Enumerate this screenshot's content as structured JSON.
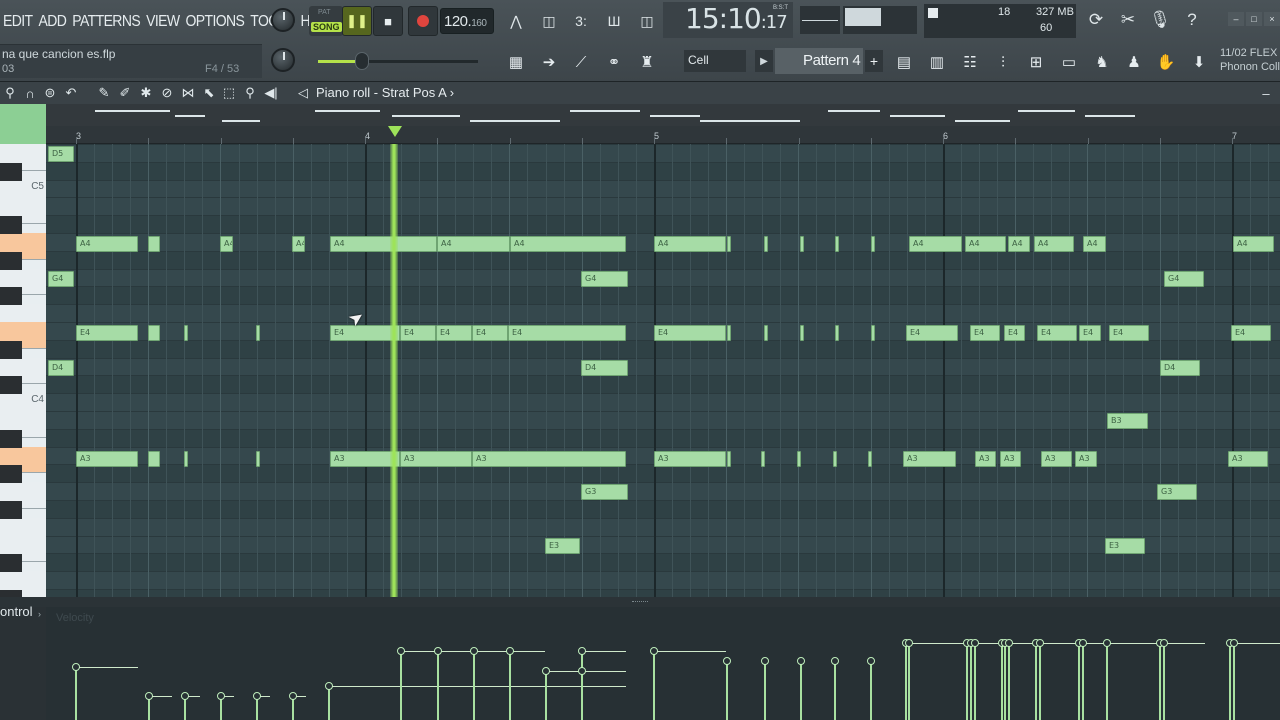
{
  "menu": [
    "EDIT",
    "ADD",
    "PATTERNS",
    "VIEW",
    "OPTIONS",
    "TOOLS",
    "HELP"
  ],
  "file": {
    "name": "na que cancion es.flp",
    "index": "03",
    "position": "F4 / 53"
  },
  "transport": {
    "song_label": "SONG",
    "pat_label": "PAT",
    "play_icon": "pause-icon",
    "stop_icon": "stop-icon",
    "record_icon": "record-icon",
    "tempo": "120.",
    "tempo_decimal": "160",
    "time_main": "15:10",
    "time_sub": ":17",
    "time_unit": "B:S:T"
  },
  "perf": {
    "poly": "18",
    "memory": "327 MB",
    "voices": "60"
  },
  "snap": "Cell",
  "pattern": "Pattern 4",
  "news": {
    "date": "11/02",
    "label": "FLEX",
    "text": "Phonon Coll"
  },
  "piano_roll": {
    "title": "Piano roll - Strat Pos A",
    "title_arrow": "›"
  },
  "ruler_numbers": [
    "3",
    "4",
    "5",
    "6",
    "7"
  ],
  "key_labels": [
    "C5",
    "C4"
  ],
  "control": {
    "label": "ontrol",
    "arrow": "›",
    "ghost": "Velocity"
  },
  "notes": [
    {
      "label": "D5"
    },
    {
      "label": "A4"
    },
    {
      "label": ""
    },
    {
      "label": "A4"
    },
    {
      "label": "A4"
    },
    {
      "label": "A4"
    },
    {
      "label": "A4"
    },
    {
      "label": "A4"
    },
    {
      "label": "A4"
    },
    {
      "label": ""
    },
    {
      "label": ""
    },
    {
      "label": ""
    },
    {
      "label": ""
    },
    {
      "label": ""
    },
    {
      "label": "A4"
    },
    {
      "label": "A4"
    },
    {
      "label": "A4"
    },
    {
      "label": "A4"
    },
    {
      "label": "A4"
    },
    {
      "label": "A4"
    },
    {
      "label": "G4"
    },
    {
      "label": "G4"
    },
    {
      "label": "G4"
    },
    {
      "label": "E4"
    },
    {
      "label": ""
    },
    {
      "label": ""
    },
    {
      "label": ""
    },
    {
      "label": "E4"
    },
    {
      "label": "E4"
    },
    {
      "label": "E4"
    },
    {
      "label": "E4"
    },
    {
      "label": "E4"
    },
    {
      "label": "E4"
    },
    {
      "label": ""
    },
    {
      "label": ""
    },
    {
      "label": ""
    },
    {
      "label": ""
    },
    {
      "label": ""
    },
    {
      "label": "E4"
    },
    {
      "label": "E4"
    },
    {
      "label": "E4"
    },
    {
      "label": "E4"
    },
    {
      "label": "E4"
    },
    {
      "label": "E4"
    },
    {
      "label": "E4"
    },
    {
      "label": "D4"
    },
    {
      "label": "D4"
    },
    {
      "label": "D4"
    },
    {
      "label": "B3"
    },
    {
      "label": "A3"
    },
    {
      "label": ""
    },
    {
      "label": ""
    },
    {
      "label": ""
    },
    {
      "label": "A3"
    },
    {
      "label": "A3"
    },
    {
      "label": "A3"
    },
    {
      "label": "A3"
    },
    {
      "label": ""
    },
    {
      "label": ""
    },
    {
      "label": ""
    },
    {
      "label": ""
    },
    {
      "label": ""
    },
    {
      "label": "A3"
    },
    {
      "label": "A3"
    },
    {
      "label": "A3"
    },
    {
      "label": "A3"
    },
    {
      "label": "A3"
    },
    {
      "label": "A3"
    },
    {
      "label": "G3"
    },
    {
      "label": "G3"
    },
    {
      "label": "E3"
    },
    {
      "label": "E3"
    }
  ],
  "colors": {
    "note": "#a6dca6",
    "playhead": "#9ee35a",
    "accent": "#b5e24a",
    "record": "#e0453e"
  }
}
